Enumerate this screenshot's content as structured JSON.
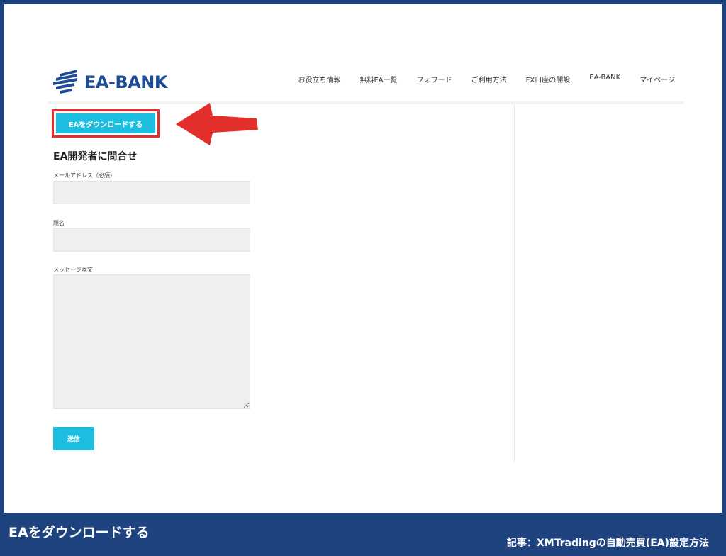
{
  "site": {
    "logo_text": "EA-BANK",
    "brand_color": "#1f4d95",
    "accent_color": "#1dbde0",
    "highlight_color": "#e32f2c"
  },
  "nav": {
    "items": [
      {
        "label": "お役立ち情報"
      },
      {
        "label": "無料EA一覧"
      },
      {
        "label": "フォワード"
      },
      {
        "label": "ご利用方法"
      },
      {
        "label": "FX口座の開設"
      },
      {
        "label": "EA-BANK"
      },
      {
        "label": "マイページ"
      }
    ]
  },
  "download": {
    "label": "EAをダウンロードする"
  },
  "contact_form": {
    "title": "EA開発者に問合せ",
    "email_label": "メールアドレス（必須）",
    "email_value": "",
    "subject_label": "題名",
    "subject_value": "",
    "message_label": "メッセージ本文",
    "message_value": "",
    "submit_label": "送信"
  },
  "caption": {
    "main": "EAをダウンロードする",
    "sub": "記事：XMTradingの自動売買(EA)設定方法"
  }
}
